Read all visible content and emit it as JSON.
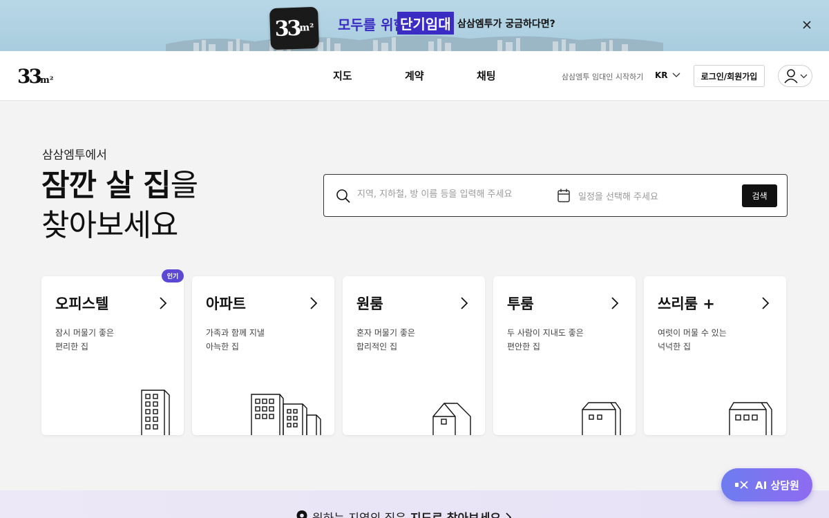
{
  "banner": {
    "logo_main": "33",
    "logo_sub": "m²",
    "headline_pre": "모두를 위한",
    "headline_highlight": "단기임대",
    "question": "삼삼엠투가 궁금하다면?"
  },
  "header": {
    "logo_main": "33",
    "logo_sub": "m²",
    "nav": [
      "지도",
      "계약",
      "채팅"
    ],
    "start_link": "삼삼엠투 임대인 시작하기",
    "lang": "KR",
    "login_label": "로그인/회원가입"
  },
  "hero": {
    "subtitle": "삼삼엠투에서",
    "title_bold": "잠깐 살 집",
    "title_rest": "을",
    "title_line2": "찾아보세요"
  },
  "search": {
    "keyword_placeholder": "지역, 지하철, 방 이름 등을 입력해 주세요",
    "date_placeholder": "일정을 선택해 주세요",
    "button_label": "검색"
  },
  "cards": [
    {
      "title": "오피스텔",
      "desc1": "잠시 머물기 좋은",
      "desc2": "편리한 집",
      "badge": "인기"
    },
    {
      "title": "아파트",
      "desc1": "가족과 함께 지낼",
      "desc2": "아늑한 집"
    },
    {
      "title": "원룸",
      "desc1": "혼자 머물기 좋은",
      "desc2": "합리적인 집"
    },
    {
      "title": "투룸",
      "desc1": "두 사람이 지내도 좋은",
      "desc2": "편안한 집"
    },
    {
      "title": "쓰리룸 +",
      "desc1": "여럿이 머물 수 있는",
      "desc2": "넉넉한 집"
    }
  ],
  "bottom": {
    "pre": "원하는 지역의 집은",
    "bold": "지도로 찾아보세요"
  },
  "ai_button": {
    "label": "AI 상담원"
  },
  "colors": {
    "accent": "#5b49d6",
    "banner_brand": "#3b2cc4",
    "button_dark": "#111111"
  }
}
